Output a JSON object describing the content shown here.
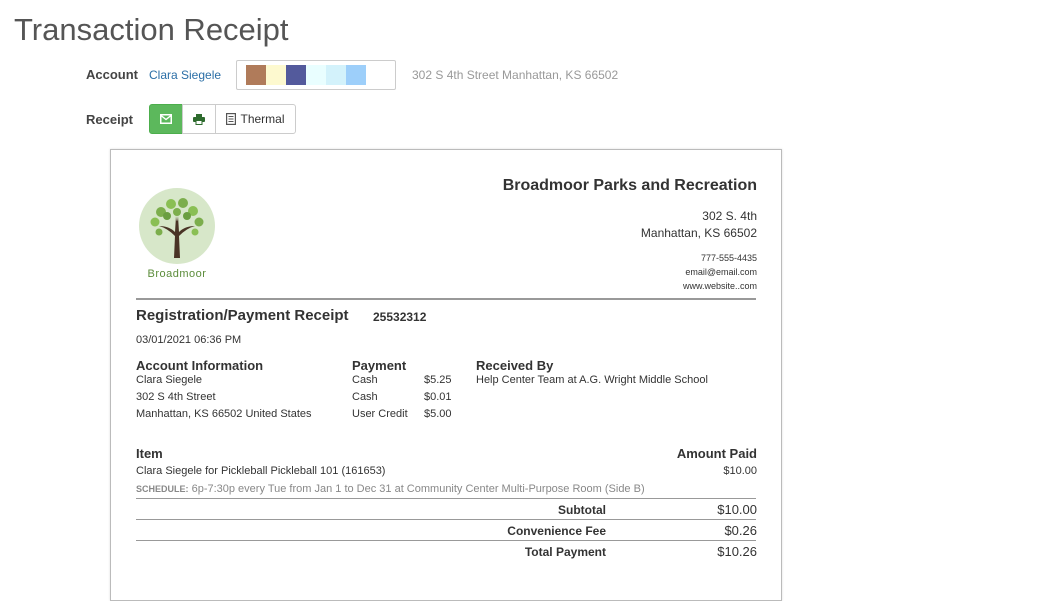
{
  "page": {
    "title": "Transaction Receipt"
  },
  "account": {
    "label": "Account",
    "name": "Clara Siegele",
    "address": "302 S 4th Street Manhattan, KS 66502",
    "swatches": [
      "#b07b5a",
      "#fdf9cf",
      "#535a9c",
      "#e9feff",
      "#d3f2fb",
      "#9dcffa"
    ]
  },
  "receipt_controls": {
    "label": "Receipt",
    "email_icon": "envelope-icon",
    "print_icon": "printer-icon",
    "thermal_label": "Thermal",
    "accent": "#5cb85c"
  },
  "receipt": {
    "logo_text": "Broadmoor",
    "org_name": "Broadmoor Parks and Recreation",
    "org_address_line1": "302 S. 4th",
    "org_address_line2": "Manhattan, KS 66502",
    "phone": "777-555-4435",
    "email": "email@email.com",
    "website": "www.website..com",
    "title": "Registration/Payment Receipt",
    "number": "25532312",
    "date": "03/01/2021 06:36 PM",
    "account_info": {
      "heading": "Account Information",
      "lines": [
        "Clara Siegele",
        "302 S 4th Street",
        "Manhattan, KS 66502 United States"
      ]
    },
    "payment": {
      "heading": "Payment",
      "rows": [
        {
          "method": "Cash",
          "amount": "$5.25"
        },
        {
          "method": "Cash",
          "amount": "$0.01"
        },
        {
          "method": "User Credit",
          "amount": "$5.00"
        }
      ]
    },
    "received_by": {
      "heading": "Received By",
      "value": "Help Center Team at A.G. Wright Middle School"
    },
    "items": {
      "item_heading": "Item",
      "amount_heading": "Amount Paid",
      "line": "Clara Siegele for Pickleball Pickleball 101 (161653)",
      "line_amount": "$10.00",
      "schedule_label": "SCHEDULE:",
      "schedule_text": "6p-7:30p every Tue from Jan 1 to Dec 31 at Community Center Multi-Purpose Room (Side B)"
    },
    "totals": [
      {
        "label": "Subtotal",
        "value": "$10.00"
      },
      {
        "label": "Convenience Fee",
        "value": "$0.26"
      },
      {
        "label": "Total Payment",
        "value": "$10.26"
      }
    ]
  }
}
